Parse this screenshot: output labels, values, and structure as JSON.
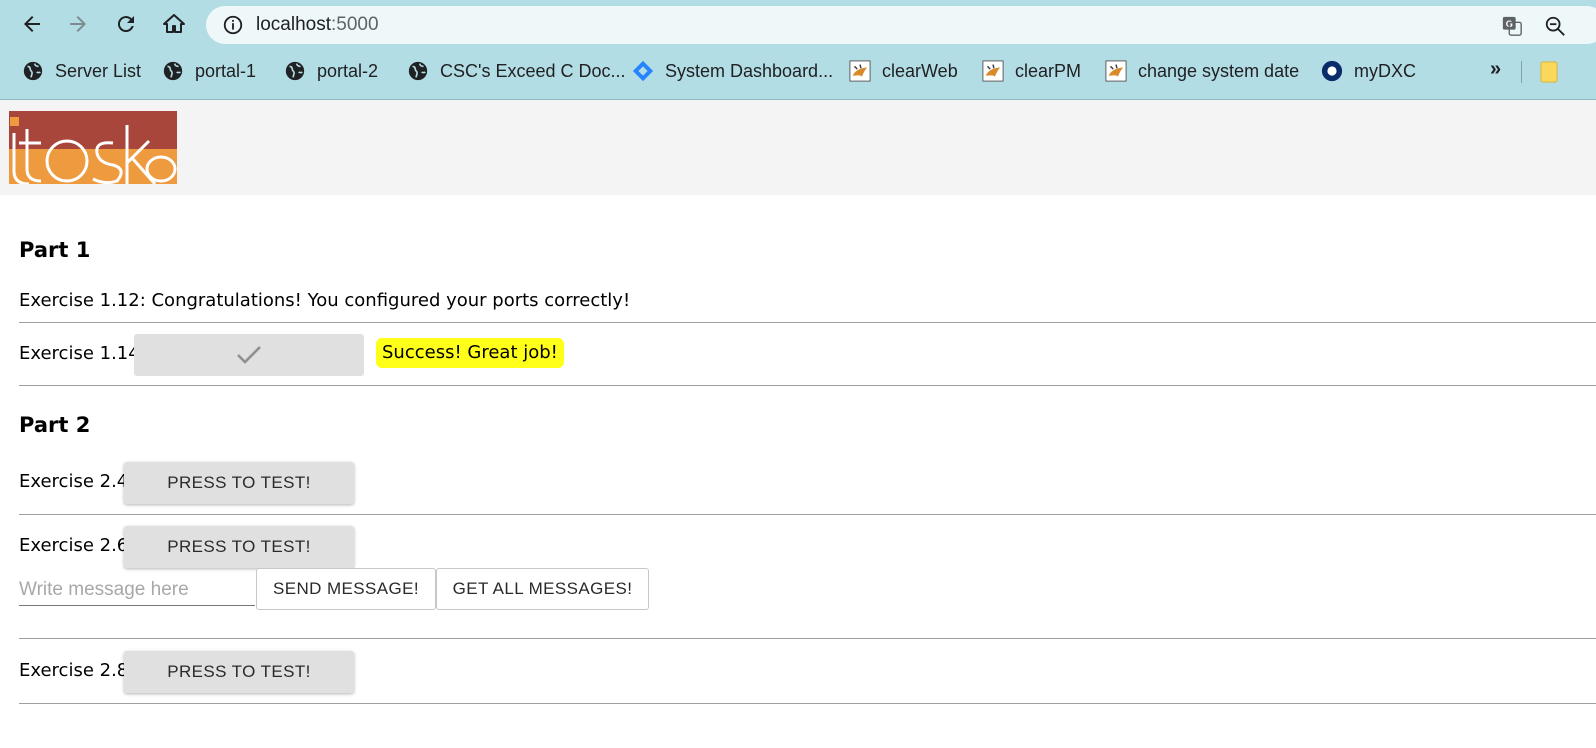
{
  "browser": {
    "url_host": "localhost",
    "url_port": ":5000",
    "bookmarks": [
      {
        "label": "Server List",
        "icon": "globe-icon"
      },
      {
        "label": "portal-1",
        "icon": "globe-icon"
      },
      {
        "label": "portal-2",
        "icon": "globe-icon"
      },
      {
        "label": "CSC's Exceed C Doc...",
        "icon": "globe-icon"
      },
      {
        "label": "System Dashboard...",
        "icon": "jira-icon"
      },
      {
        "label": "clearWeb",
        "icon": "tomcat-icon"
      },
      {
        "label": "clearPM",
        "icon": "tomcat-icon"
      },
      {
        "label": "change system date",
        "icon": "tomcat-icon"
      },
      {
        "label": "myDXC",
        "icon": "dxc-icon"
      }
    ],
    "more_label": "»"
  },
  "page": {
    "part1": {
      "heading": "Part 1",
      "ex112_text": "Exercise 1.12: Congratulations! You configured your ports correctly!",
      "ex114_label": "Exercise 1.14:",
      "ex114_button_icon": "checkmark-icon",
      "ex114_result": "Success! Great job!"
    },
    "part2": {
      "heading": "Part 2",
      "ex24_label": "Exercise 2.4:",
      "ex24_button": "PRESS TO TEST!",
      "ex26_label": "Exercise 2.6:",
      "ex26_button": "PRESS TO TEST!",
      "message_placeholder": "Write message here",
      "send_button": "SEND MESSAGE!",
      "get_all_button": "GET ALL MESSAGES!",
      "ex28_label": "Exercise 2.8:",
      "ex28_button": "PRESS TO TEST!"
    }
  },
  "colors": {
    "chrome_bg": "#b3dde4",
    "highlight": "#ffff1a",
    "logo_red": "#a8463c",
    "logo_orange": "#ee9a3e"
  }
}
